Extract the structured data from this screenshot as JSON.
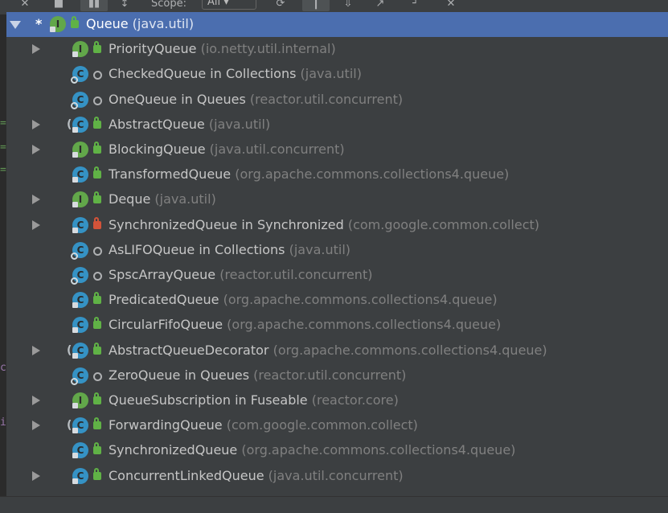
{
  "toolbar": {
    "scope_label": "Scope:",
    "scope_value": "All"
  },
  "tree": {
    "rows": [
      {
        "name": "Queue",
        "pkg": "(java.util)",
        "kind": "interface",
        "vis": "public",
        "arrow": "down",
        "star": true,
        "selected": true
      },
      {
        "name": "PriorityQueue",
        "pkg": "(io.netty.util.internal)",
        "kind": "interface",
        "vis": "public",
        "arrow": "right"
      },
      {
        "name": "CheckedQueue in Collections",
        "pkg": "(java.util)",
        "kind": "class",
        "vis": "package",
        "arrow": "none"
      },
      {
        "name": "OneQueue in Queues",
        "pkg": "(reactor.util.concurrent)",
        "kind": "class",
        "vis": "package",
        "arrow": "none"
      },
      {
        "name": "AbstractQueue",
        "pkg": "(java.util)",
        "kind": "abstract",
        "vis": "public",
        "arrow": "right"
      },
      {
        "name": "BlockingQueue",
        "pkg": "(java.util.concurrent)",
        "kind": "interface",
        "vis": "public",
        "arrow": "right"
      },
      {
        "name": "TransformedQueue",
        "pkg": "(org.apache.commons.collections4.queue)",
        "kind": "class",
        "vis": "public",
        "arrow": "none"
      },
      {
        "name": "Deque",
        "pkg": "(java.util)",
        "kind": "interface",
        "vis": "public",
        "arrow": "right"
      },
      {
        "name": "SynchronizedQueue in Synchronized",
        "pkg": "(com.google.common.collect)",
        "kind": "class",
        "vis": "private",
        "arrow": "right"
      },
      {
        "name": "AsLIFOQueue in Collections",
        "pkg": "(java.util)",
        "kind": "class",
        "vis": "package",
        "arrow": "none"
      },
      {
        "name": "SpscArrayQueue",
        "pkg": "(reactor.util.concurrent)",
        "kind": "class",
        "vis": "package",
        "arrow": "none"
      },
      {
        "name": "PredicatedQueue",
        "pkg": "(org.apache.commons.collections4.queue)",
        "kind": "class",
        "vis": "public",
        "arrow": "none"
      },
      {
        "name": "CircularFifoQueue",
        "pkg": "(org.apache.commons.collections4.queue)",
        "kind": "class",
        "vis": "public",
        "arrow": "none"
      },
      {
        "name": "AbstractQueueDecorator",
        "pkg": "(org.apache.commons.collections4.queue)",
        "kind": "abstract",
        "vis": "public",
        "arrow": "right"
      },
      {
        "name": "ZeroQueue in Queues",
        "pkg": "(reactor.util.concurrent)",
        "kind": "class",
        "vis": "package",
        "arrow": "none"
      },
      {
        "name": "QueueSubscription in Fuseable",
        "pkg": "(reactor.core)",
        "kind": "interface",
        "vis": "public",
        "arrow": "right"
      },
      {
        "name": "ForwardingQueue",
        "pkg": "(com.google.common.collect)",
        "kind": "abstract",
        "vis": "public",
        "arrow": "right"
      },
      {
        "name": "SynchronizedQueue",
        "pkg": "(org.apache.commons.collections4.queue)",
        "kind": "class",
        "vis": "public",
        "arrow": "none"
      },
      {
        "name": "ConcurrentLinkedQueue",
        "pkg": "(java.util.concurrent)",
        "kind": "class",
        "vis": "public",
        "arrow": "right"
      }
    ]
  },
  "colors": {
    "selection": "#4b6eaf",
    "interface_icon": "#62a74a",
    "class_icon": "#3592c4",
    "public_vis": "#60b246",
    "private_vis": "#d25339"
  }
}
